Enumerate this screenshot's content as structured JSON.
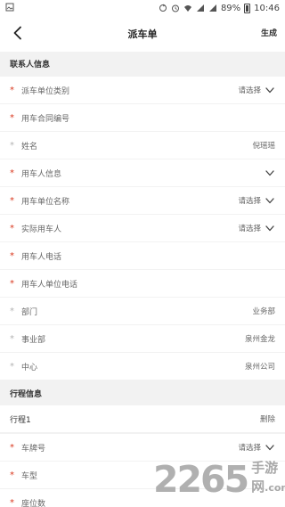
{
  "status_bar": {
    "battery": "89%",
    "time": "10:46"
  },
  "header": {
    "title": "派车单",
    "action_label": "生成"
  },
  "sections": {
    "contact_title": "联系人信息",
    "trip_title": "行程信息"
  },
  "contact_fields": [
    {
      "label": "派车单位类别",
      "value": "请选择",
      "required": true,
      "dropdown": true
    },
    {
      "label": "用车合同编号",
      "value": "",
      "required": true,
      "dropdown": false
    },
    {
      "label": "姓名",
      "value": "倪瑶瑶",
      "required": false,
      "dropdown": false
    },
    {
      "label": "用车人信息",
      "value": "",
      "required": true,
      "dropdown": true
    },
    {
      "label": "用车单位名称",
      "value": "请选择",
      "required": true,
      "dropdown": true
    },
    {
      "label": "实际用车人",
      "value": "请选择",
      "required": true,
      "dropdown": true
    },
    {
      "label": "用车人电话",
      "value": "",
      "required": true,
      "dropdown": false
    },
    {
      "label": "用车人单位电话",
      "value": "",
      "required": true,
      "dropdown": false
    },
    {
      "label": "部门",
      "value": "业务部",
      "required": false,
      "dropdown": false
    },
    {
      "label": "事业部",
      "value": "泉州金龙",
      "required": false,
      "dropdown": false
    },
    {
      "label": "中心",
      "value": "泉州公司",
      "required": false,
      "dropdown": false
    }
  ],
  "trip": {
    "name": "行程1",
    "delete_label": "删除",
    "fields": [
      {
        "label": "车牌号",
        "value": "请选择",
        "required": true,
        "dropdown": true
      },
      {
        "label": "车型",
        "value": "",
        "required": true,
        "dropdown": false
      },
      {
        "label": "座位数",
        "value": "",
        "required": true,
        "dropdown": false
      }
    ]
  },
  "watermark": {
    "number": "2265",
    "text": "手游网",
    "suffix": ".com"
  },
  "colors": {
    "required_marker": "#d9381e",
    "page_background": "#f2f2f2"
  }
}
